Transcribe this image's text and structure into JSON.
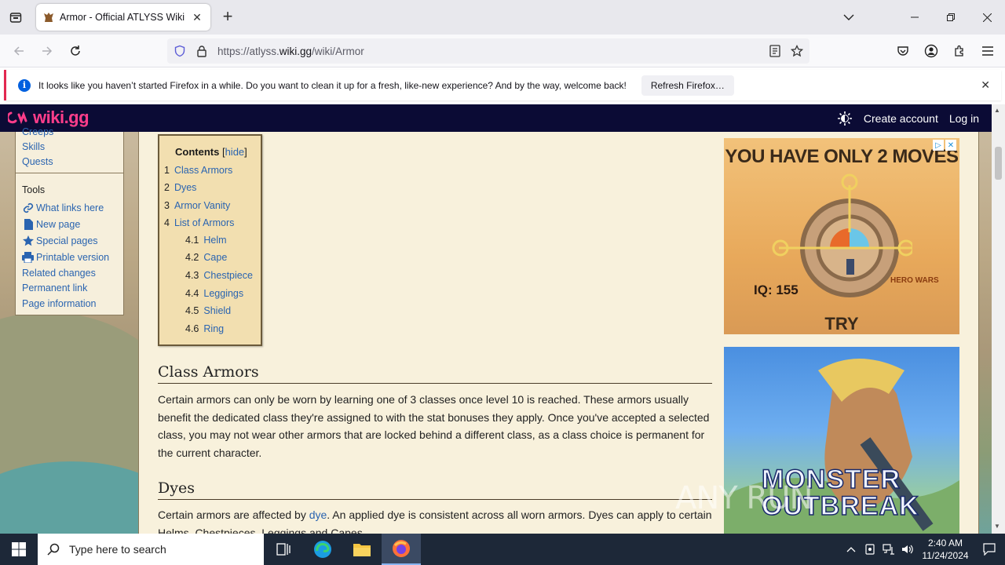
{
  "browser": {
    "tab_title": "Armor - Official ATLYSS Wiki",
    "url_prefix": "https://atlyss.",
    "url_host": "wiki.gg",
    "url_path": "/wiki/Armor",
    "notice_text": "It looks like you haven’t started Firefox in a while. Do you want to clean it up for a fresh, like-new experience? And by the way, welcome back!",
    "notice_button": "Refresh Firefox…"
  },
  "site": {
    "logo": "wiki.gg",
    "create_account": "Create account",
    "log_in": "Log in"
  },
  "sidebar": {
    "links_top": [
      "Creeps",
      "Skills",
      "Quests"
    ],
    "tools_heading": "Tools",
    "tools": [
      {
        "label": "What links here",
        "icon": "link-icon"
      },
      {
        "label": "New page",
        "icon": "page-icon"
      },
      {
        "label": "Special pages",
        "icon": "star-icon"
      },
      {
        "label": "Printable version",
        "icon": "printer-icon"
      },
      {
        "label": "Related changes",
        "icon": ""
      },
      {
        "label": "Permanent link",
        "icon": ""
      },
      {
        "label": "Page information",
        "icon": ""
      }
    ]
  },
  "toc": {
    "title": "Contents",
    "hide": "hide",
    "items": [
      {
        "num": "1",
        "label": "Class Armors"
      },
      {
        "num": "2",
        "label": "Dyes"
      },
      {
        "num": "3",
        "label": "Armor Vanity"
      },
      {
        "num": "4",
        "label": "List of Armors"
      },
      {
        "num": "4.1",
        "label": "Helm"
      },
      {
        "num": "4.2",
        "label": "Cape"
      },
      {
        "num": "4.3",
        "label": "Chestpiece"
      },
      {
        "num": "4.4",
        "label": "Leggings"
      },
      {
        "num": "4.5",
        "label": "Shield"
      },
      {
        "num": "4.6",
        "label": "Ring"
      }
    ]
  },
  "article": {
    "h_class": "Class Armors",
    "p_class": "Certain armors can only be worn by learning one of 3 classes once level 10 is reached. These armors usually benefit the dedicated class they're assigned to with the stat bonuses they apply. Once you've accepted a selected class, you may not wear other armors that are locked behind a different class, as a class choice is permanent for the current character.",
    "h_dyes": "Dyes",
    "p_dyes_before": "Certain armors are affected by ",
    "p_dyes_link": "dye",
    "p_dyes_after": ". An applied dye is consistent across all worn armors. Dyes can apply to certain Helms, Chestpieces, Leggings and Capes."
  },
  "ads": {
    "ad1_headline": "YOU HAVE ONLY 2 MOVES",
    "ad1_iq": "IQ: 155",
    "ad1_cta": "TRY",
    "ad1_brand": "HERO WARS",
    "ad2_title_line1": "MONSTER",
    "ad2_title_line2": "OUTBREAK",
    "watermark": "ANY RUN"
  },
  "taskbar": {
    "search_placeholder": "Type here to search",
    "time": "2:40 AM",
    "date": "11/24/2024"
  },
  "colors": {
    "site_header": "#0b0b35",
    "logo": "#ff3d8a",
    "link": "#2a64b0",
    "notice_accent": "#e22850"
  }
}
